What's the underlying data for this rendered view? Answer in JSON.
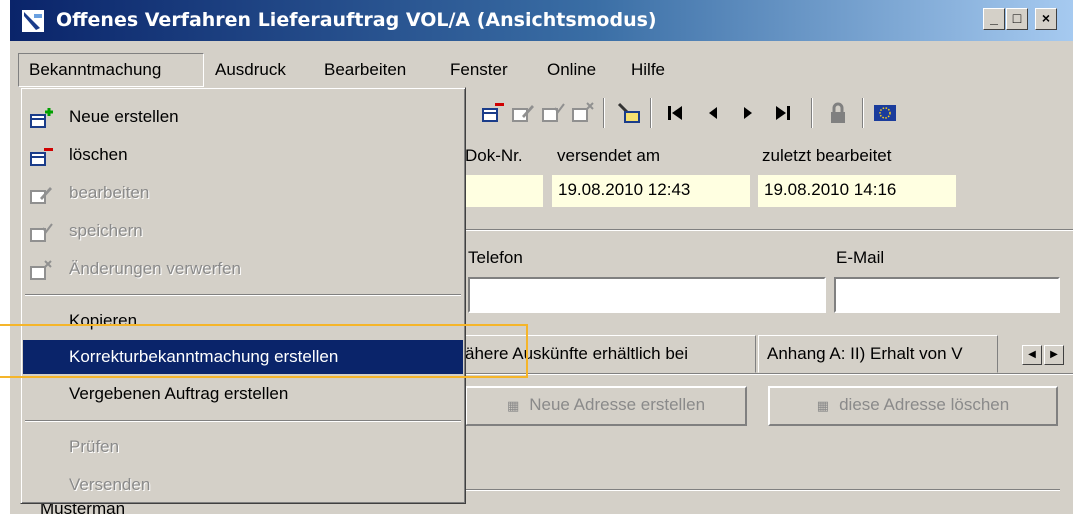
{
  "window": {
    "title": "Offenes Verfahren Lieferauftrag VOL/A (Ansichtsmodus)",
    "controls": {
      "minimize": "_",
      "maximize": "□",
      "close": "×"
    }
  },
  "menubar": {
    "items": [
      "Bekanntmachung",
      "Ausdruck",
      "Bearbeiten",
      "Fenster",
      "Online",
      "Hilfe"
    ]
  },
  "dropdown": {
    "items": [
      {
        "label": "Neue erstellen",
        "icon": "table-add-icon"
      },
      {
        "label": "löschen",
        "icon": "table-delete-icon"
      },
      {
        "label": "bearbeiten",
        "icon": "table-edit-icon",
        "disabled": true
      },
      {
        "label": "speichern",
        "icon": "table-save-icon",
        "disabled": true
      },
      {
        "label": "Änderungen verwerfen",
        "icon": "table-discard-icon",
        "disabled": true
      },
      {
        "label": "Kopieren"
      },
      {
        "label": "Korrekturbekanntmachung erstellen",
        "highlighted": true
      },
      {
        "label": "Vergebenen Auftrag erstellen"
      },
      {
        "label": "Prüfen",
        "disabled": true
      },
      {
        "label": "Versenden",
        "disabled": true
      }
    ]
  },
  "document_info": {
    "dok_nr_label": "Dok-Nr.",
    "dok_nr_value": "",
    "versendet_label": "versendet am",
    "versendet_value": "19.08.2010 12:43",
    "bearbeitet_label": "zuletzt bearbeitet",
    "bearbeitet_value": "19.08.2010 14:16"
  },
  "contact": {
    "telefon_label": "Telefon",
    "telefon_value": "",
    "email_label": "E-Mail",
    "email_value": ""
  },
  "tabs": [
    "ähere Auskünfte erhältlich bei",
    "Anhang A: II) Erhalt von V"
  ],
  "buttons": {
    "new_address": "Neue Adresse erstellen",
    "delete_address": "diese Adresse löschen"
  },
  "bottom_text": "Musterman",
  "colors": {
    "highlight": "#0a246a",
    "annotation_box": "#f5b52a",
    "date_field_bg": "#ffffe1"
  }
}
